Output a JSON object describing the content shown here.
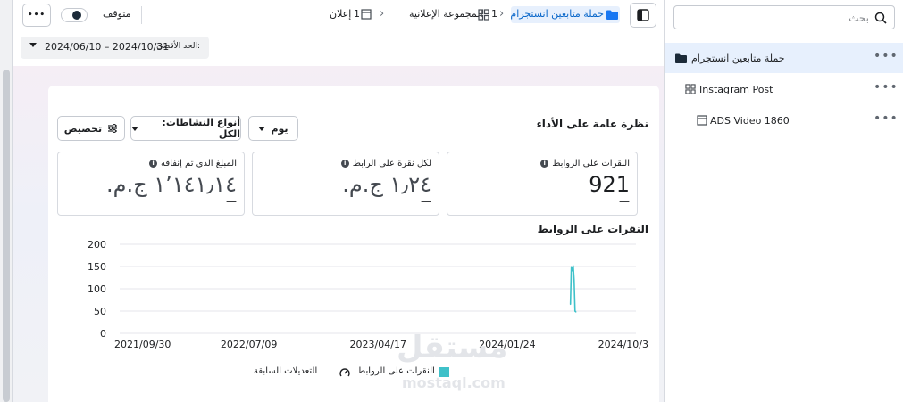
{
  "topbar": {
    "more_label": "•••",
    "status_label": "متوقف",
    "breadcrumb": {
      "campaign": "حملة متابعين انستجرام",
      "adset_count": "1",
      "adset_label": "المجموعة الإعلانية",
      "ad_count": "1",
      "ad_label": "إعلان"
    }
  },
  "date_filter": {
    "prefix": "الحد الأقصى:",
    "range": "2024/06/10 – 2024/10/31"
  },
  "sidebar": {
    "search_placeholder": "بحث",
    "items": [
      {
        "label": "حملة متابعين انستجرام",
        "more": "•••"
      },
      {
        "label": "Instagram Post",
        "more": "•••"
      },
      {
        "label": "ADS Video 1860",
        "more": "•••"
      }
    ]
  },
  "overview": {
    "title": "نظرة عامة على الأداء",
    "controls": {
      "period": "يوم",
      "activity": "أنواع النشاطات: الكل",
      "customize": "تخصيص"
    },
    "metrics": [
      {
        "title": "النقرات على الروابط",
        "value": "921",
        "delta": "—"
      },
      {
        "title": "لكل نقرة على الرابط",
        "value": "١٫٢٤ ج.م.‏",
        "delta": "—"
      },
      {
        "title": "المبلغ الذي تم إنفاقه",
        "value": "١٬١٤١٫١٤ ج.م.‏",
        "delta": "—"
      }
    ]
  },
  "chart_data": {
    "type": "line",
    "title": "النقرات على الروابط",
    "y_ticks": [
      "200",
      "150",
      "100",
      "50",
      "0"
    ],
    "ylim": [
      0,
      200
    ],
    "x_ticks": [
      "2021/09/30",
      "2022/07/09",
      "2023/04/17",
      "2024/01/24",
      "2024/10/3"
    ],
    "x_tick_values": [
      "2021-09-30",
      "2022-07-09",
      "2023-04-17",
      "2024-01-24",
      "2024-10-31"
    ],
    "grid": true,
    "series": [
      {
        "name": "النقرات على الروابط",
        "color": "#3fc1c9",
        "x": [
          "2024-06-10",
          "2024-06-12",
          "2024-06-14",
          "2024-06-16",
          "2024-06-18",
          "2024-06-20",
          "2024-06-22"
        ],
        "y": [
          65,
          150,
          140,
          152,
          120,
          50,
          48
        ]
      }
    ],
    "legend": {
      "placement": "bottom",
      "items": [
        {
          "label": "النقرات على الروابط",
          "color": "#3fc1c9"
        },
        {
          "label": "التعديلات السابقة"
        }
      ]
    }
  },
  "watermark": {
    "brand": "مستقل",
    "site": "mostaql.com"
  }
}
